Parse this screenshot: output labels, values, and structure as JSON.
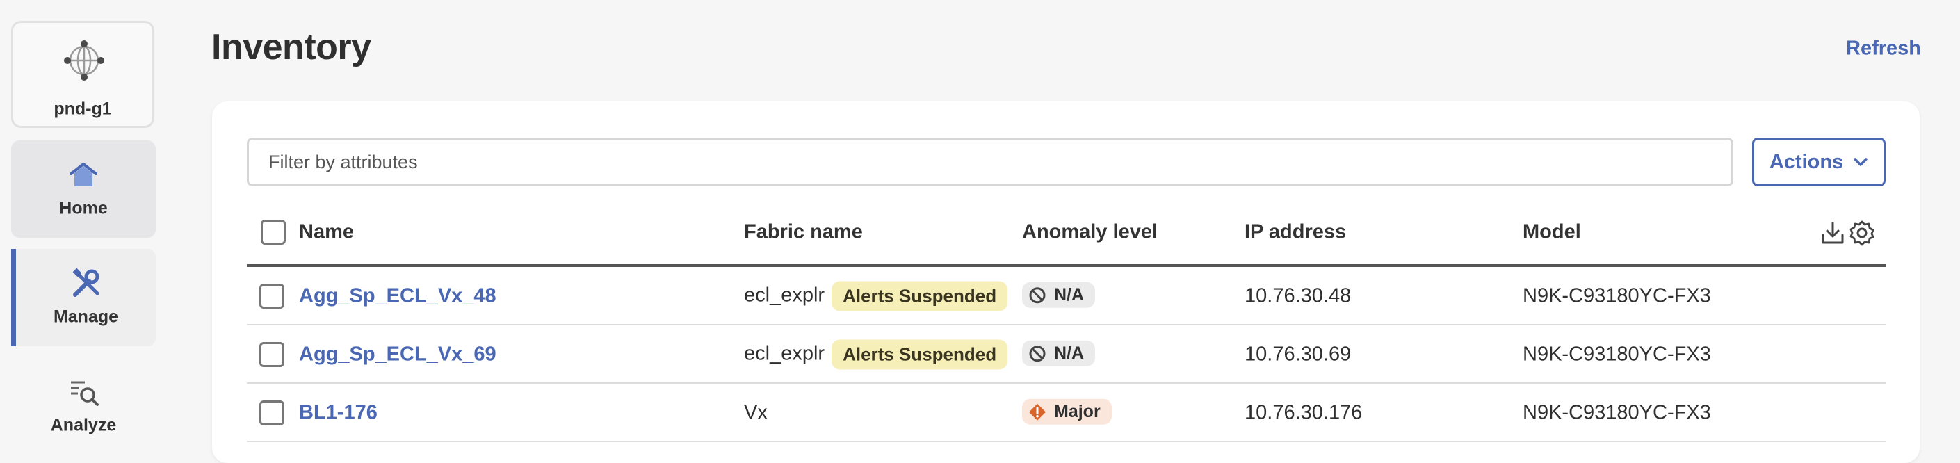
{
  "sidebar": {
    "site": {
      "label": "pnd-g1",
      "icon": "globe-network-icon"
    },
    "items": [
      {
        "label": "Home",
        "icon": "home-icon"
      },
      {
        "label": "Manage",
        "icon": "tools-icon"
      },
      {
        "label": "Analyze",
        "icon": "analyze-search-icon"
      }
    ]
  },
  "header": {
    "title": "Inventory",
    "refresh_label": "Refresh"
  },
  "toolbar": {
    "filter_placeholder": "Filter by attributes",
    "actions_label": "Actions"
  },
  "table": {
    "columns": [
      "Name",
      "Fabric name",
      "Anomaly level",
      "IP address",
      "Model"
    ],
    "rows": [
      {
        "name": "Agg_Sp_ECL_Vx_48",
        "fabric": "ecl_explr",
        "fabric_badge": "Alerts Suspended",
        "anomaly": "N/A",
        "ip": "10.76.30.48",
        "model": "N9K-C93180YC-FX3"
      },
      {
        "name": "Agg_Sp_ECL_Vx_69",
        "fabric": "ecl_explr",
        "fabric_badge": "Alerts Suspended",
        "anomaly": "N/A",
        "ip": "10.76.30.69",
        "model": "N9K-C93180YC-FX3"
      },
      {
        "name": "BL1-176",
        "fabric": "Vx",
        "anomaly": "Major",
        "ip": "10.76.30.176",
        "model": "N9K-C93180YC-FX3"
      }
    ]
  },
  "colors": {
    "accent": "#4a67b4",
    "badge_suspended": "#f7efb8",
    "anomaly_major": "#d9652b",
    "anomaly_na": "#ebebeb"
  }
}
